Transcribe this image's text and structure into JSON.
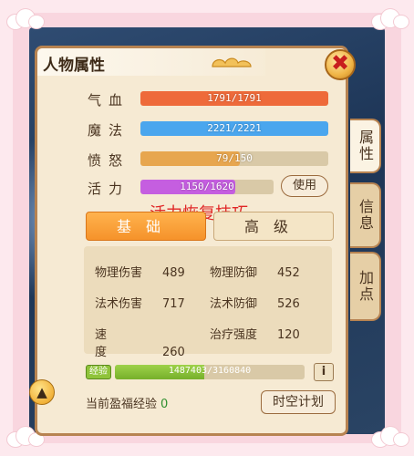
{
  "panel": {
    "title": "人物属性"
  },
  "side_tabs": [
    {
      "label": "属性",
      "active": true
    },
    {
      "label": "信息",
      "active": false
    },
    {
      "label": "加点",
      "active": false
    }
  ],
  "stats": [
    {
      "label": "气血",
      "value": "1791/1791",
      "fill": 1.0,
      "color": "#ee6a3a"
    },
    {
      "label": "魔法",
      "value": "2221/2221",
      "fill": 1.0,
      "color": "#4aa6ee"
    },
    {
      "label": "愤怒",
      "value": "79/150",
      "fill": 0.527,
      "color": "#e7a64f"
    },
    {
      "label": "活力",
      "value": "1150/1620",
      "fill": 0.71,
      "color": "#c55ee0"
    }
  ],
  "use_button": "使用",
  "overlay_text": "活力恢复技巧",
  "tabs": {
    "basic": "基础",
    "advanced": "高级"
  },
  "attributes": [
    {
      "name": "物理伤害",
      "value": "489"
    },
    {
      "name": "物理防御",
      "value": "452"
    },
    {
      "name": "法术伤害",
      "value": "717"
    },
    {
      "name": "法术防御",
      "value": "526"
    },
    {
      "name": "速度",
      "value": "260"
    },
    {
      "name": "治疗强度",
      "value": "120"
    }
  ],
  "experience": {
    "badge": "经验",
    "value": "1487403/3160840",
    "fill": 0.47
  },
  "info_button": "i",
  "blessing": {
    "label": "当前盈福经验",
    "value": "0"
  },
  "plan_button": "时空计划",
  "colors": {
    "panel_bg": "#f6ead3",
    "border": "#b78351",
    "accent_orange": "#f5922a",
    "overlay_red": "#e02727"
  }
}
